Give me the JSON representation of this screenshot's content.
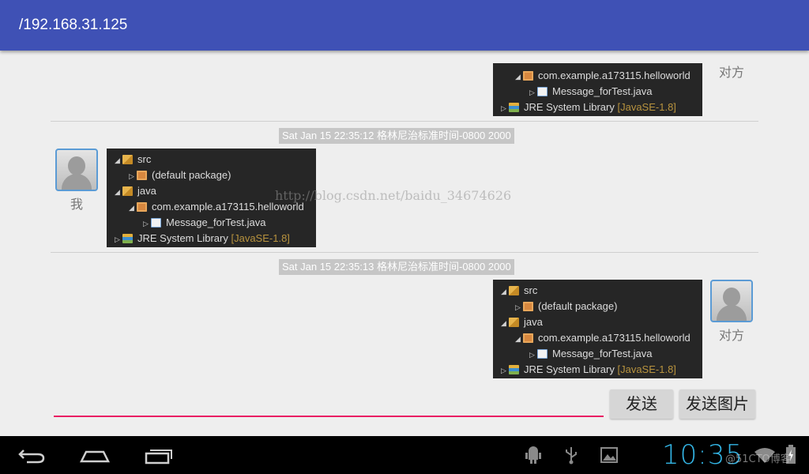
{
  "header": {
    "title": "/192.168.31.125"
  },
  "messages": [
    {
      "side": "right",
      "sender": "对方",
      "tree": [
        {
          "indent": 1,
          "twisty": "◢",
          "icon": "package-icon",
          "label": "com.example.a173115.helloworld"
        },
        {
          "indent": 2,
          "twisty": "▷",
          "icon": "java-file-icon",
          "label": "Message_forTest.java"
        },
        {
          "indent": 0,
          "twisty": "▷",
          "icon": "library-icon",
          "label": "JRE System Library",
          "suffix": "[JavaSE-1.8]"
        }
      ]
    },
    {
      "side": "left",
      "time": "Sat Jan 15 22:35:12 格林尼治标准时间-0800 2000",
      "sender": "我",
      "tree": [
        {
          "indent": 0,
          "twisty": "◢",
          "icon": "source-folder-icon",
          "label": "src"
        },
        {
          "indent": 1,
          "twisty": "▷",
          "icon": "package-icon",
          "label": "(default package)"
        },
        {
          "indent": 0,
          "twisty": "◢",
          "icon": "folder-icon",
          "label": "java"
        },
        {
          "indent": 1,
          "twisty": "◢",
          "icon": "package-icon",
          "label": "com.example.a173115.helloworld"
        },
        {
          "indent": 2,
          "twisty": "▷",
          "icon": "java-file-icon",
          "label": "Message_forTest.java"
        },
        {
          "indent": 0,
          "twisty": "▷",
          "icon": "library-icon",
          "label": "JRE System Library",
          "suffix": "[JavaSE-1.8]"
        }
      ]
    },
    {
      "side": "right",
      "time": "Sat Jan 15 22:35:13 格林尼治标准时间-0800 2000",
      "sender": "对方",
      "tree": [
        {
          "indent": 0,
          "twisty": "◢",
          "icon": "source-folder-icon",
          "label": "src"
        },
        {
          "indent": 1,
          "twisty": "▷",
          "icon": "package-icon",
          "label": "(default package)"
        },
        {
          "indent": 0,
          "twisty": "◢",
          "icon": "folder-icon",
          "label": "java"
        },
        {
          "indent": 1,
          "twisty": "◢",
          "icon": "package-icon",
          "label": "com.example.a173115.helloworld"
        },
        {
          "indent": 2,
          "twisty": "▷",
          "icon": "java-file-icon",
          "label": "Message_forTest.java"
        },
        {
          "indent": 0,
          "twisty": "▷",
          "icon": "library-icon",
          "label": "JRE System Library",
          "suffix": "[JavaSE-1.8]"
        }
      ]
    }
  ],
  "watermark": "http://blog.csdn.net/baidu_34674626",
  "composer": {
    "value": "",
    "send_label": "发送",
    "send_image_label": "发送图片"
  },
  "navbar": {
    "clock": "10:35",
    "watermark": "@51CTO博客"
  },
  "colors": {
    "appbar": "#3f51b5",
    "accent": "#e91e63",
    "clock": "#33b5e5"
  }
}
